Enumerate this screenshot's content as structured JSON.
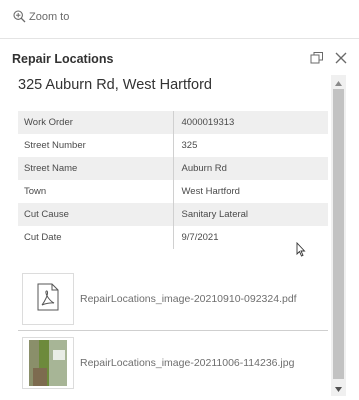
{
  "toolbar": {
    "zoom_label": "Zoom to"
  },
  "popup": {
    "title": "Repair Locations",
    "feature_title": "325 Auburn Rd, West Hartford"
  },
  "attributes": [
    {
      "field": "Work Order",
      "value": "4000019313"
    },
    {
      "field": "Street Number",
      "value": "325"
    },
    {
      "field": "Street Name",
      "value": "Auburn Rd"
    },
    {
      "field": "Town",
      "value": "West Hartford"
    },
    {
      "field": "Cut Cause",
      "value": "Sanitary Lateral"
    },
    {
      "field": "Cut Date",
      "value": "9/7/2021"
    }
  ],
  "attachments": [
    {
      "name": "RepairLocations_image-20210910-092324.pdf",
      "type": "pdf-icon"
    },
    {
      "name": "RepairLocations_image-20211006-114236.jpg",
      "type": "photo-thumbnail"
    }
  ]
}
